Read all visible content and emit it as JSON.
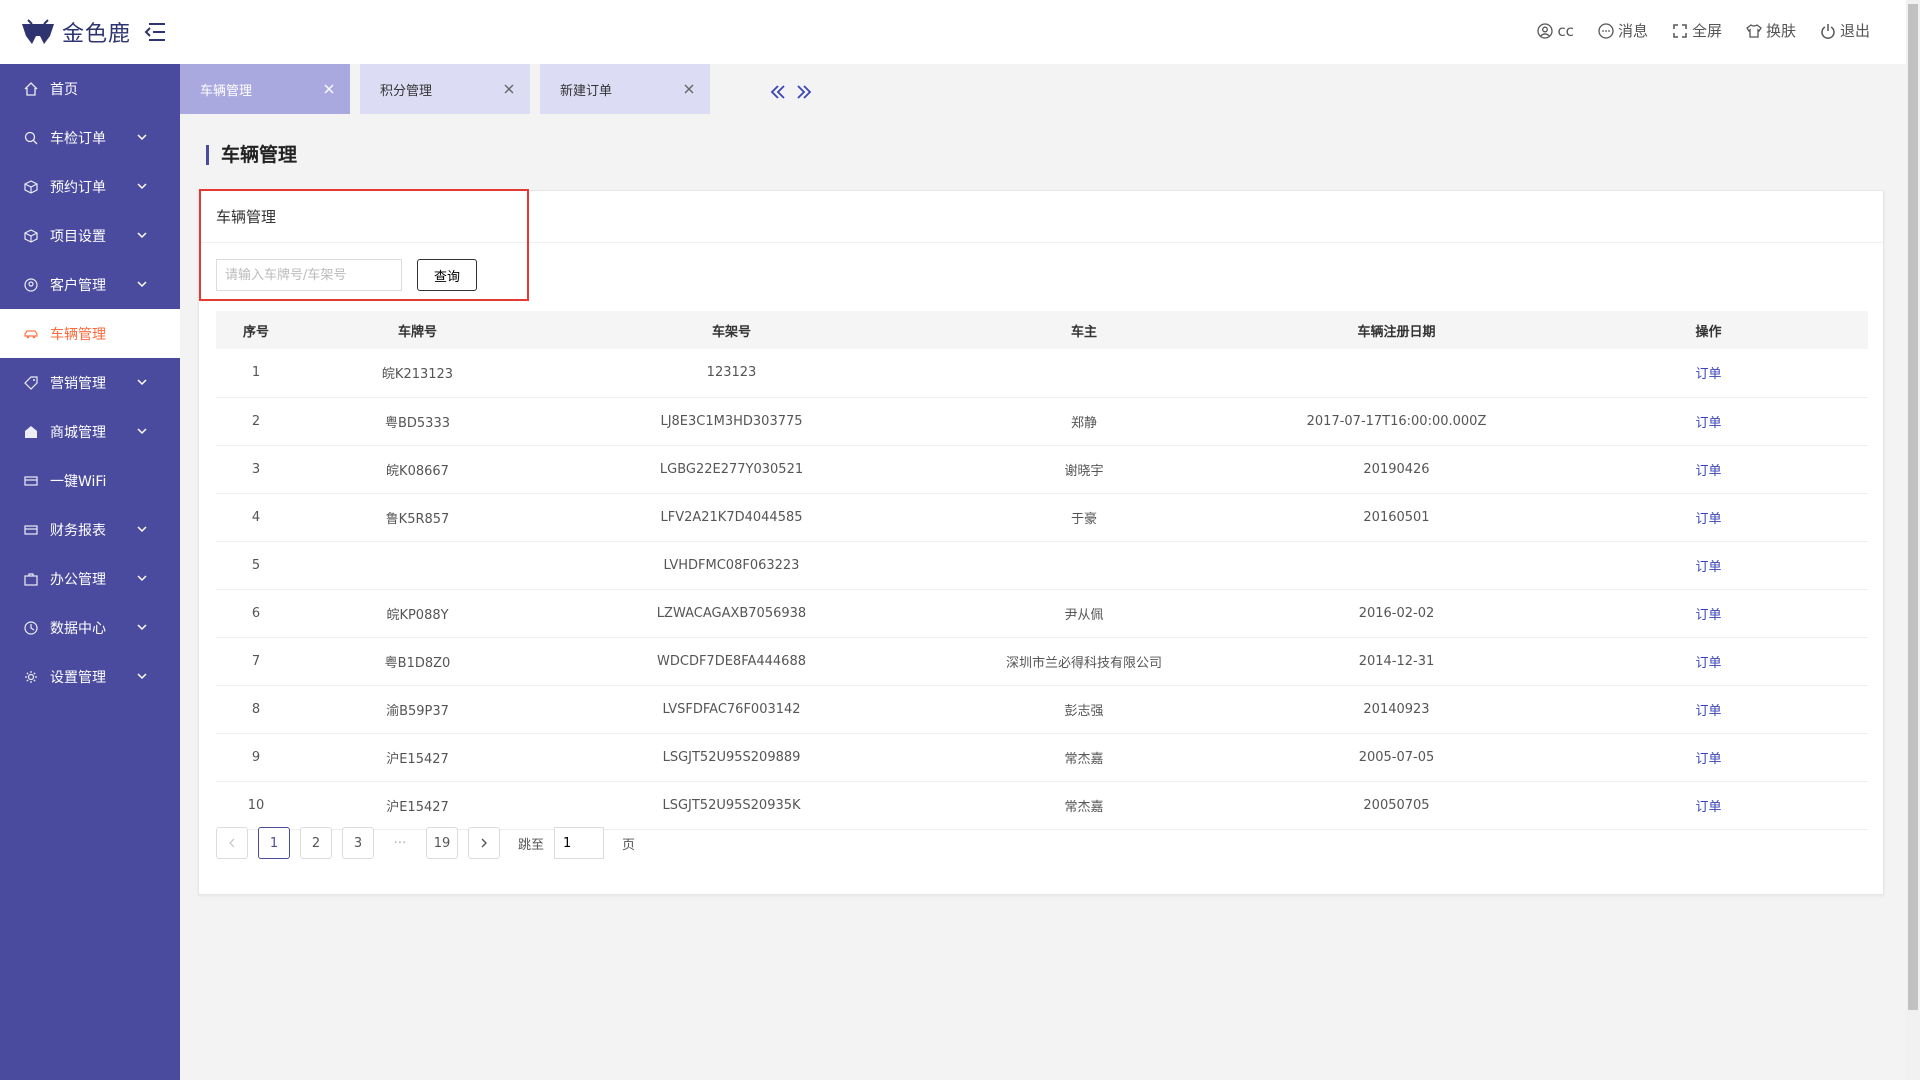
{
  "app": {
    "logo_text": "金色鹿"
  },
  "header": {
    "actions": [
      {
        "label": "cc",
        "icon": "user-icon"
      },
      {
        "label": "消息",
        "icon": "message-icon"
      },
      {
        "label": "全屏",
        "icon": "fullscreen-icon"
      },
      {
        "label": "换肤",
        "icon": "shirt-icon"
      },
      {
        "label": "退出",
        "icon": "power-icon"
      }
    ]
  },
  "sidebar": {
    "items": [
      {
        "label": "首页",
        "icon": "home-icon"
      },
      {
        "label": "车检订单",
        "icon": "search-icon"
      },
      {
        "label": "预约订单",
        "icon": "box-icon"
      },
      {
        "label": "项目设置",
        "icon": "box-icon"
      },
      {
        "label": "客户管理",
        "icon": "user-icon"
      },
      {
        "label": "车辆管理",
        "icon": "car-icon"
      },
      {
        "label": "营销管理",
        "icon": "tag-icon"
      },
      {
        "label": "商城管理",
        "icon": "shop-icon"
      },
      {
        "label": "一键WiFi",
        "icon": "wifi-icon"
      },
      {
        "label": "财务报表",
        "icon": "report-icon"
      },
      {
        "label": "办公管理",
        "icon": "briefcase-icon"
      },
      {
        "label": "数据中心",
        "icon": "clock-icon"
      },
      {
        "label": "设置管理",
        "icon": "gear-icon"
      }
    ]
  },
  "tabs": [
    {
      "label": "车辆管理"
    },
    {
      "label": "积分管理"
    },
    {
      "label": "新建订单"
    }
  ],
  "page": {
    "title": "车辆管理",
    "card_title": "车辆管理",
    "search_placeholder": "请输入车牌号/车架号",
    "search_button": "查询"
  },
  "table": {
    "headers": [
      "序号",
      "车牌号",
      "车架号",
      "车主",
      "车辆注册日期",
      "操作"
    ],
    "rows": [
      [
        "1",
        "皖K213123",
        "123123",
        "",
        "",
        "订单"
      ],
      [
        "2",
        "粤BD5333",
        "LJ8E3C1M3HD303775",
        "郑静",
        "2017-07-17T16:00:00.000Z",
        "订单"
      ],
      [
        "3",
        "皖K08667",
        "LGBG22E277Y030521",
        "谢晓宇",
        "20190426",
        "订单"
      ],
      [
        "4",
        "鲁K5R857",
        "LFV2A21K7D4044585",
        "于豪",
        "20160501",
        "订单"
      ],
      [
        "5",
        "",
        "LVHDFMC08F063223",
        "",
        "",
        "订单"
      ],
      [
        "6",
        "皖KP088Y",
        "LZWACAGAXB7056938",
        "尹从佩",
        "2016-02-02",
        "订单"
      ],
      [
        "7",
        "粤B1D8Z0",
        "WDCDF7DE8FA444688",
        "深圳市兰必得科技有限公司",
        "2014-12-31",
        "订单"
      ],
      [
        "8",
        "渝B59P37",
        "LVSFDFAC76F003142",
        "彭志强",
        "20140923",
        "订单"
      ],
      [
        "9",
        "沪E15427",
        "LSGJT52U95S209889",
        "常杰嘉",
        "2005-07-05",
        "订单"
      ],
      [
        "10",
        "沪E15427",
        "LSGJT52U95S20935K",
        "常杰嘉",
        "20050705",
        "订单"
      ]
    ]
  },
  "pagination": {
    "pages": [
      "1",
      "2",
      "3"
    ],
    "ellipsis": "···",
    "last_page": "19",
    "current": "1",
    "jump_label": "跳至",
    "jump_value": "1",
    "page_suffix": "页"
  },
  "colors": {
    "sidebar_bg": "#4a4a9f",
    "active_nav_text": "#ff6a3a",
    "active_tab_bg": "#a9a9e0",
    "tab_bg": "#dcdcf4",
    "link": "#3a44b8",
    "highlight": "#e53935"
  }
}
